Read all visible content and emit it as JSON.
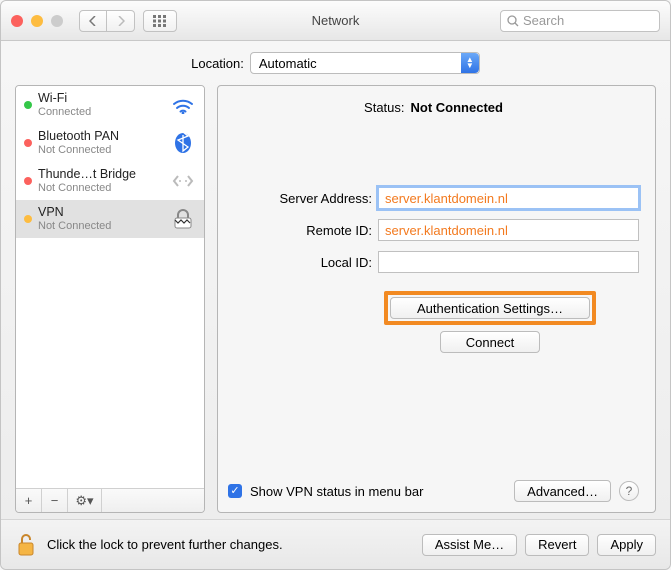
{
  "window": {
    "title": "Network"
  },
  "toolbar": {
    "search_placeholder": "Search"
  },
  "location": {
    "label": "Location:",
    "value": "Automatic"
  },
  "services": [
    {
      "name": "Wi-Fi",
      "sub": "Connected",
      "status": "green",
      "icon": "wifi",
      "selected": false
    },
    {
      "name": "Bluetooth PAN",
      "sub": "Not Connected",
      "status": "red",
      "icon": "bluetooth",
      "selected": false
    },
    {
      "name": "Thunde…t Bridge",
      "sub": "Not Connected",
      "status": "red",
      "icon": "thunderbolt",
      "selected": false
    },
    {
      "name": "VPN",
      "sub": "Not Connected",
      "status": "yellow",
      "icon": "vpn",
      "selected": true
    }
  ],
  "sidebar_buttons": {
    "add": "+",
    "remove": "−",
    "gear": "⚙︎▾"
  },
  "detail": {
    "status_label": "Status:",
    "status_value": "Not Connected",
    "server_address_label": "Server Address:",
    "server_address_value": "server.klantdomein.nl",
    "remote_id_label": "Remote ID:",
    "remote_id_value": "server.klantdomein.nl",
    "local_id_label": "Local ID:",
    "local_id_value": "",
    "auth_settings_label": "Authentication Settings…",
    "connect_label": "Connect",
    "show_status_label": "Show VPN status in menu bar",
    "show_status_checked": true,
    "advanced_label": "Advanced…"
  },
  "footer": {
    "lock_text": "Click the lock to prevent further changes.",
    "assist": "Assist Me…",
    "revert": "Revert",
    "apply": "Apply"
  },
  "colors": {
    "accent": "#f28a22"
  }
}
